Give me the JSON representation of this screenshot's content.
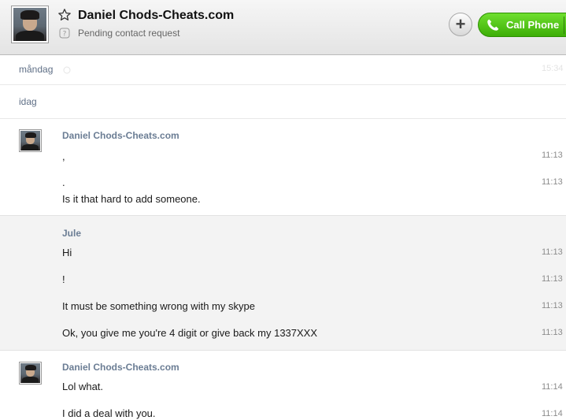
{
  "header": {
    "contact_name": "Daniel Chods-Cheats.com",
    "status": "Pending contact request",
    "call_label": "Call Phone"
  },
  "days": [
    {
      "label": "måndag",
      "faded_time": "15:34"
    },
    {
      "label": "idag"
    }
  ],
  "groups": [
    {
      "sender": "Daniel Chods-Cheats.com",
      "messages": [
        {
          "text": ",",
          "time": "11:13"
        },
        {
          "text": ".",
          "time": "11:13"
        },
        {
          "text": "Is it that hard to add someone.",
          "time": ""
        }
      ]
    },
    {
      "sender": "Jule",
      "messages": [
        {
          "text": "Hi",
          "time": "11:13"
        },
        {
          "text": "!",
          "time": "11:13"
        },
        {
          "text": "It must be something wrong with my skype",
          "time": "11:13"
        },
        {
          "text": "Ok, you give me you're 4 digit or give back my 1337XXX",
          "time": "11:13"
        }
      ]
    },
    {
      "sender": "Daniel Chods-Cheats.com",
      "messages": [
        {
          "text": "Lol what.",
          "time": "11:14"
        },
        {
          "text": "I did a deal with you.",
          "time": "11:14"
        }
      ]
    }
  ],
  "colors": {
    "call_green": "#3dae07",
    "sender_blue": "#6b7d94",
    "alt_background": "#f3f3f3"
  },
  "icons": [
    "star-icon",
    "pending-request-icon",
    "add-icon",
    "phone-icon"
  ]
}
